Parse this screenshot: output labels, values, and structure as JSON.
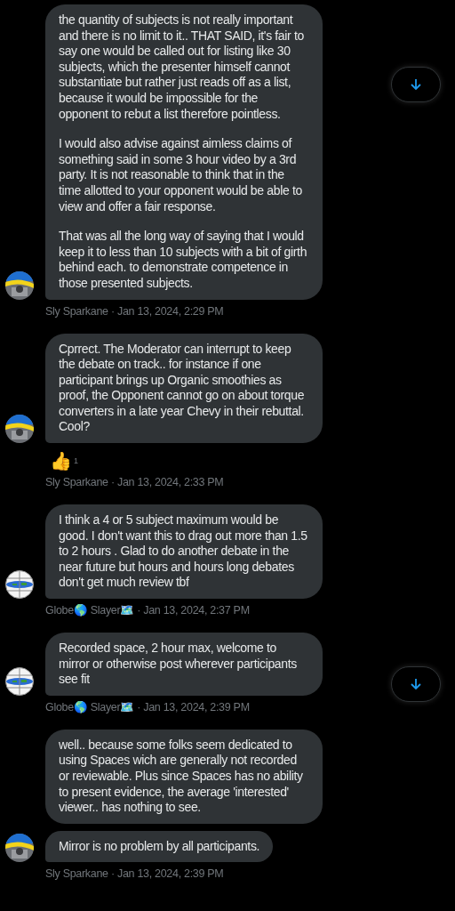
{
  "messages": [
    {
      "paragraphs": [
        "the quantity of subjects is not really important and there is no limit to it.. THAT SAID, it's fair to say one would be called out for listing like 30 subjects, which the presenter himself cannot substantiate but rather just reads off as a list, because it would be impossible for the opponent to rebut a list therefore pointless.",
        "I would also advise against aimless claims of something said in some 3 hour video by a 3rd party. It is not reasonable to think that in the time allotted to your opponent would be able to view and offer a fair response.",
        "That was all the long way of saying that I would keep it to less than 10 subjects with a bit of girth behind each. to demonstrate competence in those presented subjects."
      ],
      "avatar": {
        "kind": "flag"
      },
      "meta": "Sly Sparkane · Jan 13, 2024, 2:29 PM"
    },
    {
      "paragraphs": [
        "Cprrect. The Moderator can interrupt to keep the debate on track.. for instance if one participant brings up Organic smoothies as proof, the Opponent cannot go on about torque converters in a late year Chevy in their rebuttal. Cool?"
      ],
      "avatar": {
        "kind": "flag"
      },
      "reaction": {
        "emoji": "👍",
        "count": "1"
      },
      "meta": "Sly Sparkane · Jan 13, 2024, 2:33 PM"
    },
    {
      "paragraphs": [
        "I think a 4 or 5 subject maximum would be good. I don't want this to drag out more than 1.5 to 2 hours . Glad to do another debate in the near future but hours and hours long debates don't get much review tbf"
      ],
      "avatar": {
        "kind": "globe"
      },
      "meta": "Globe🌎 Slayer🗺️ · Jan 13, 2024, 2:37 PM"
    },
    {
      "paragraphs": [
        "Recorded space, 2 hour max, welcome to mirror or otherwise post wherever participants see fit"
      ],
      "avatar": {
        "kind": "globe"
      },
      "meta": "Globe🌎 Slayer🗺️ · Jan 13, 2024, 2:39 PM"
    },
    {
      "paragraphs": [
        "well.. because some folks seem dedicated to using Spaces wich are generally not recorded or reviewable. Plus since Spaces has no ability to present evidence, the average 'interested' viewer.. has nothing to see."
      ]
    },
    {
      "paragraphs": [
        "Mirror is no problem by all participants."
      ],
      "avatar": {
        "kind": "flag"
      },
      "meta": "Sly Sparkane · Jan 13, 2024, 2:39 PM"
    }
  ]
}
